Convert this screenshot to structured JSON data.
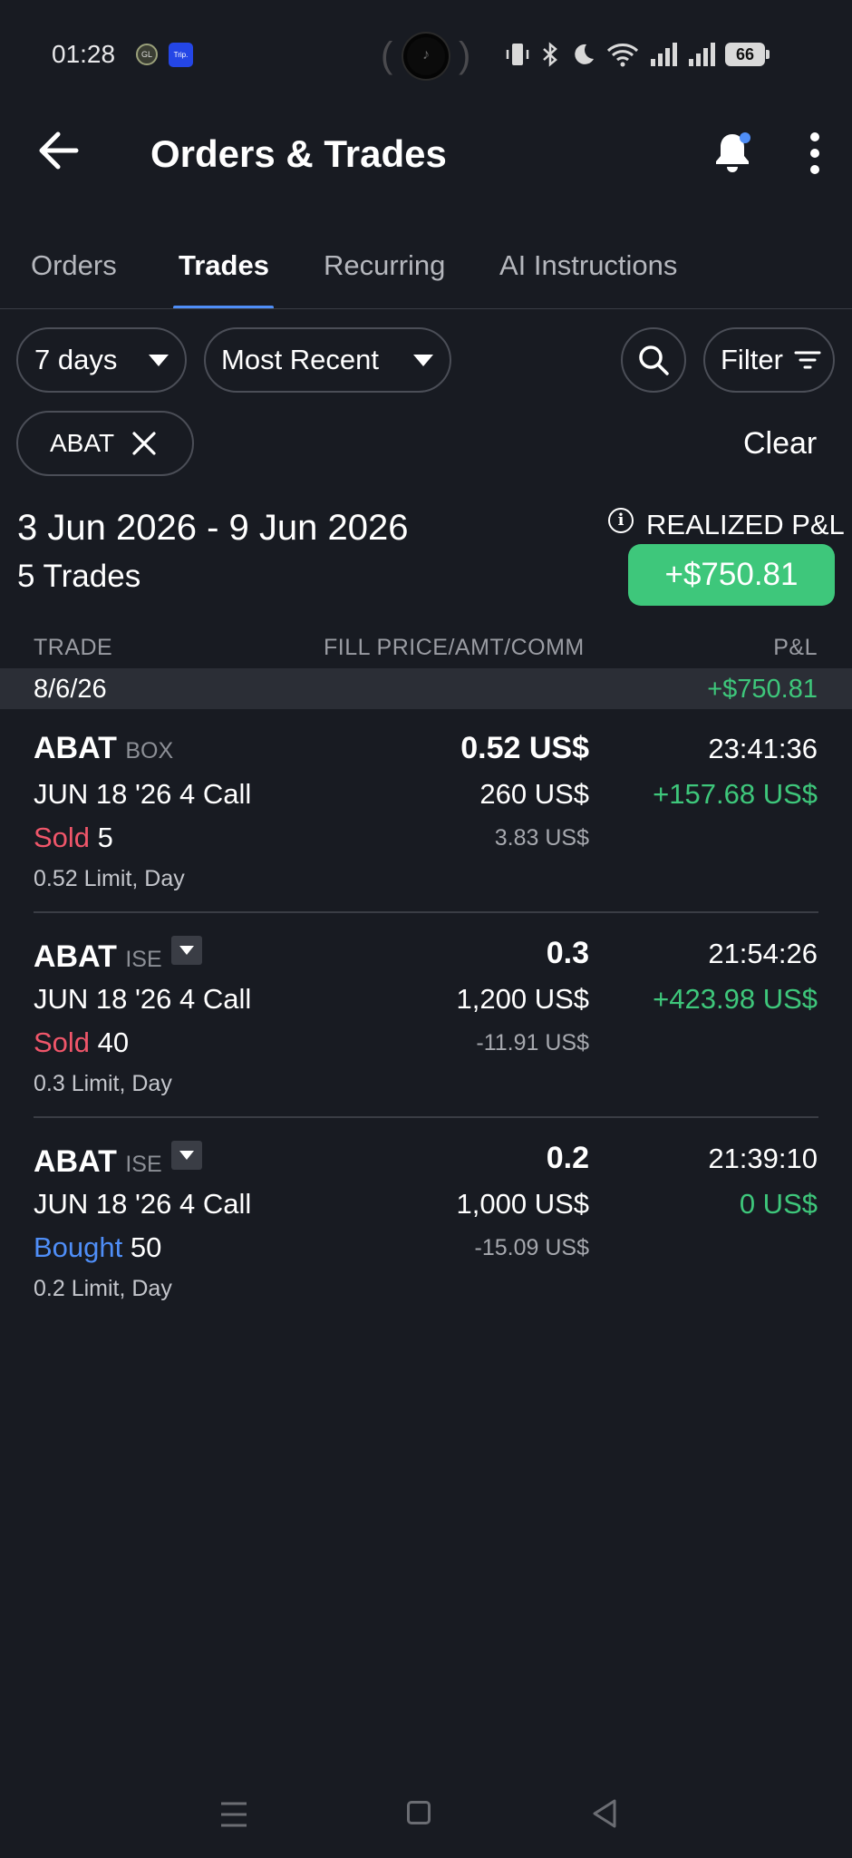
{
  "status_bar": {
    "time": "01:28",
    "app_icon_1": "GL",
    "app_icon_2": "Trip.",
    "battery": "66"
  },
  "header": {
    "title": "Orders & Trades"
  },
  "tabs": [
    {
      "label": "Orders"
    },
    {
      "label": "Trades"
    },
    {
      "label": "Recurring"
    },
    {
      "label": "AI Instructions"
    }
  ],
  "filters": {
    "period": "7 days",
    "sort": "Most Recent",
    "filter_label": "Filter",
    "symbol_chip": "ABAT",
    "clear_label": "Clear"
  },
  "summary": {
    "date_range": "3 Jun 2026 - 9 Jun 2026",
    "trade_count": "5 Trades",
    "pl_label": "REALIZED P&L",
    "pl_value": "+$750.81",
    "pl_color": "#3ec77b"
  },
  "columns": {
    "trade": "TRADE",
    "fill": "FILL PRICE/AMT/COMM",
    "pl": "P&L"
  },
  "day_group": {
    "date": "8/6/26",
    "pl": "+$750.81"
  },
  "trades": [
    {
      "symbol": "ABAT",
      "exchange": "BOX",
      "contract": "JUN 18 '26 4 Call",
      "side": "Sold",
      "qty": "5",
      "limit": "0.52 Limit, Day",
      "price": "0.52 US$",
      "amount": "260 US$",
      "commission": "3.83 US$",
      "time": "23:41:36",
      "pl": "+157.68 US$"
    },
    {
      "symbol": "ABAT",
      "exchange": "ISE",
      "contract": "JUN 18 '26 4 Call",
      "side": "Sold",
      "qty": "40",
      "limit": "0.3 Limit, Day",
      "price": "0.3",
      "amount": "1,200 US$",
      "commission": "-11.91 US$",
      "time": "21:54:26",
      "pl": "+423.98 US$"
    },
    {
      "symbol": "ABAT",
      "exchange": "ISE",
      "contract": "JUN 18 '26 4 Call",
      "side": "Bought",
      "qty": "50",
      "limit": "0.2 Limit, Day",
      "price": "0.2",
      "amount": "1,000 US$",
      "commission": "-15.09 US$",
      "time": "21:39:10",
      "pl": "0 US$"
    }
  ],
  "colors": {
    "background": "#181b22",
    "accent": "#4f8ef7",
    "positive": "#3ec77b",
    "sold": "#f0566a",
    "bought": "#4f8ef7"
  }
}
